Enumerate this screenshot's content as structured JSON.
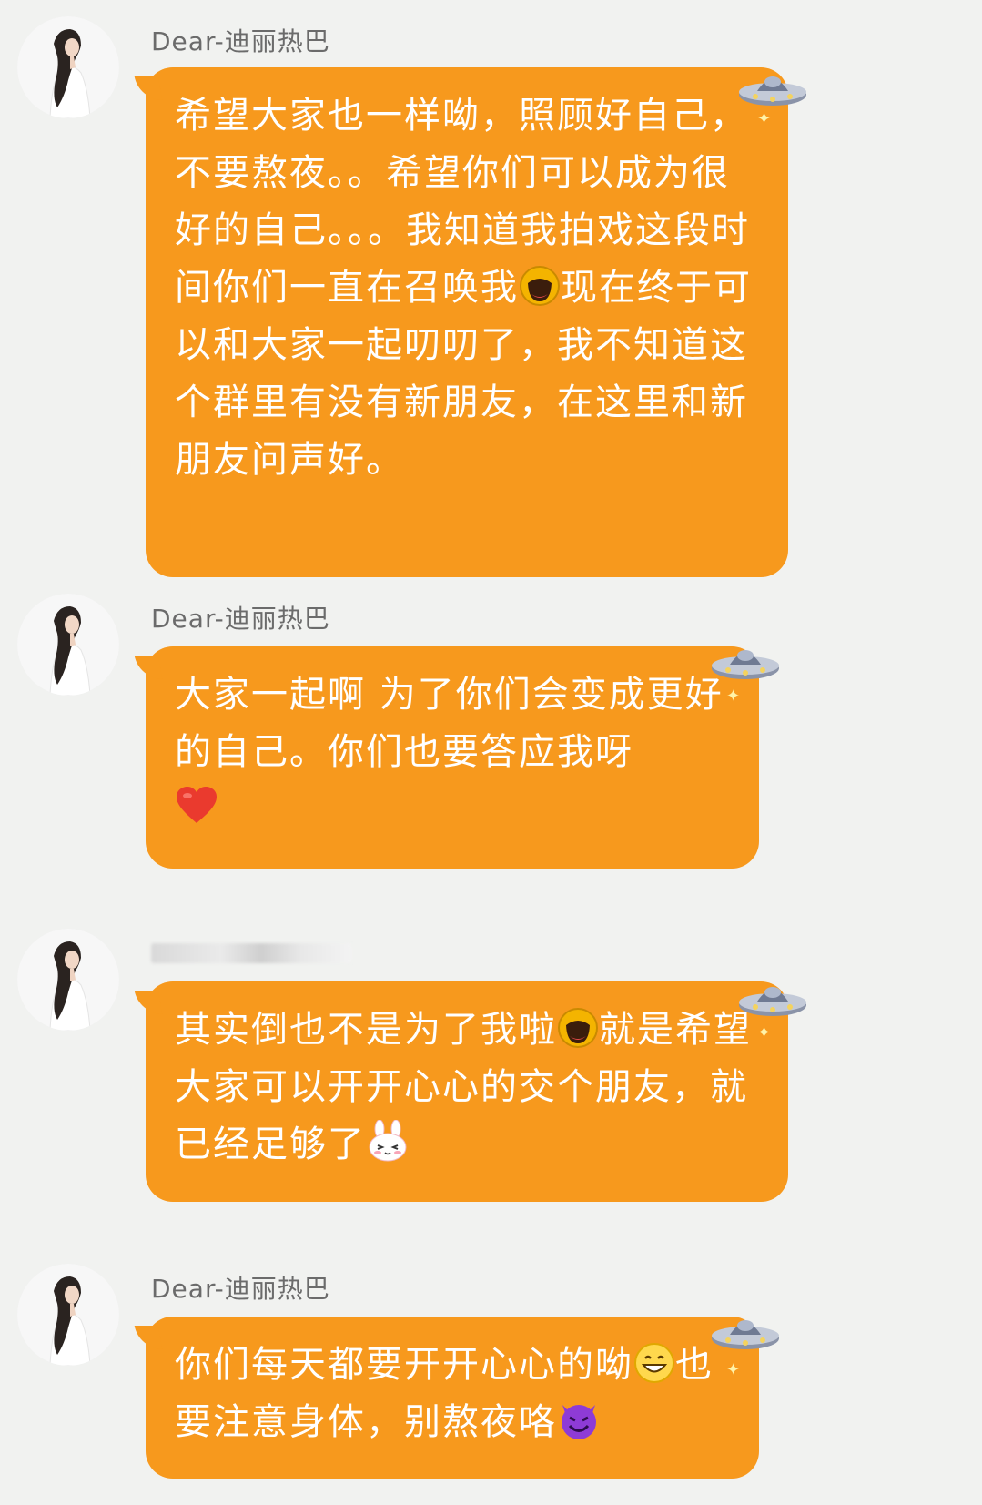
{
  "messages": [
    {
      "sender": "Dear-迪丽热巴",
      "text_1": "希望大家也一样呦，照顾好自己，不要熬夜。。希望你们可以成为很好的自己。。。我知道我拍戏这段时间你们一直在召唤我",
      "emoji_1": "grinning-face-icon",
      "text_2": "现在终于可以和大家一起叨叨了，我不知道这个群里有没有新朋友，在这里和新朋友问声好。"
    },
    {
      "sender": "Dear-迪丽热巴",
      "text_1": "大家一起啊 为了你们会变成更好的自己。你们也要答应我呀",
      "emoji_1": "red-heart-icon"
    },
    {
      "sender": "",
      "text_1": "其实倒也不是为了我啦",
      "emoji_1": "grinning-face-icon",
      "text_2": "就是希望大家可以开开心心的交个朋友，就已经足够了",
      "emoji_2": "bunny-face-icon"
    },
    {
      "sender": "Dear-迪丽热巴",
      "text_1": "你们每天都要开开心心的呦",
      "emoji_1": "smiling-face-icon",
      "text_2": "也要注意身体，别熬夜咯",
      "emoji_2": "smiling-devil-icon"
    }
  ],
  "theme": {
    "bubble_color": "#f7991d",
    "background": "#f1f2f0"
  }
}
